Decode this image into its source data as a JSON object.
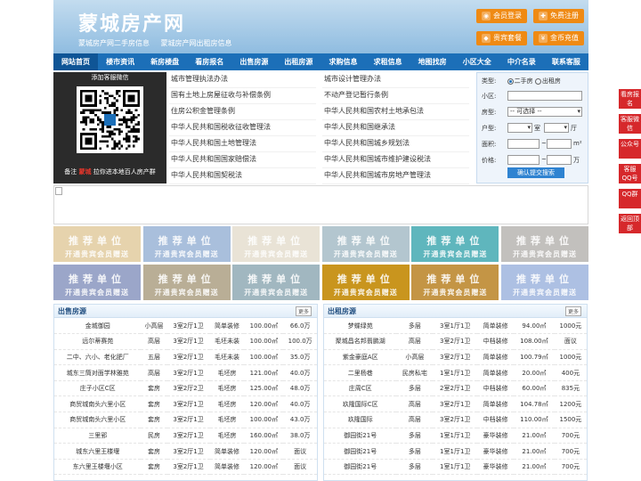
{
  "header": {
    "logo": "蒙城房产网",
    "links": [
      "蒙城房产网二手房信息",
      "蒙城房产网出租房信息"
    ],
    "buttons": [
      {
        "label": "会员登录",
        "icon": "user-icon",
        "color": "#f08c1a"
      },
      {
        "label": "免费注册",
        "icon": "register-icon",
        "color": "#f08c1a"
      },
      {
        "label": "贵宾套餐",
        "icon": "vip-icon",
        "color": "#f08c1a"
      },
      {
        "label": "金币充值",
        "icon": "coin-icon",
        "color": "#f08c1a"
      }
    ]
  },
  "nav": [
    "网站首页",
    "楼市资讯",
    "新房楼盘",
    "看房报名",
    "出售房源",
    "出租房源",
    "求购信息",
    "求租信息",
    "地图找房",
    "小区大全",
    "中介名录",
    "联系客服"
  ],
  "qr": {
    "title": "添加客服微信",
    "caption_pre": "备注",
    "caption_hl": "蒙城",
    "caption_post": "拉你进本地百人房产群"
  },
  "laws": [
    [
      "城市管理执法办法",
      "城市设计管理办法"
    ],
    [
      "国有土地上房屋征收与补偿条例",
      "不动产登记暂行条例"
    ],
    [
      "住房公积金管理条例",
      "中华人民共和国农村土地承包法"
    ],
    [
      "中华人民共和国税收征收管理法",
      "中华人民共和国继承法"
    ],
    [
      "中华人民共和国土地管理法",
      "中华人民共和国城乡规划法"
    ],
    [
      "中华人民共和国国家赔偿法",
      "中华人民共和国城市维护建设税法"
    ],
    [
      "中华人民共和国契税法",
      "中华人民共和国城市房地产管理法"
    ]
  ],
  "search": {
    "type_label": "类型:",
    "opt1": "二手房",
    "opt2": "出租房",
    "community_label": "小区:",
    "housetype_label": "房型:",
    "housetype_value": "-- 可选择 --",
    "layout_label": "户型:",
    "room": "室",
    "hall": "厅",
    "area_label": "面积:",
    "area_unit": "m²",
    "price_label": "价格:",
    "price_unit": "万",
    "dash": "~",
    "submit": "确认提交搜索"
  },
  "ads": {
    "line1": "推荐单位",
    "line2": "开通贵宾会员赠送",
    "colors": [
      "#e6d3ad",
      "#a9bfdc",
      "#e9e3d6",
      "#b3c6cf",
      "#5fb6bd",
      "#c2c0bd",
      "#9ba6c9",
      "#b9ae96",
      "#a1b7c0",
      "#c9951e",
      "#c49545",
      "#adc0e3"
    ]
  },
  "sale": {
    "title": "出售房源",
    "more": "更多",
    "rows": [
      [
        "金城御园",
        "小高层",
        "3室2厅1卫",
        "简单装修",
        "100.00㎡",
        "66.0万"
      ],
      [
        "远尔蒂赛苑",
        "高层",
        "3室2厅1卫",
        "毛坯未装",
        "100.00㎡",
        "100.0万"
      ],
      [
        "二中、六小、老化肥厂",
        "五层",
        "3室2厅1卫",
        "毛坯未装",
        "100.00㎡",
        "35.0万"
      ],
      [
        "城东三筒对面学林雅苑",
        "高层",
        "3室2厅1卫",
        "毛坯房",
        "121.00㎡",
        "40.0万"
      ],
      [
        "庄子小区C区",
        "套房",
        "3室2厅2卫",
        "毛坯房",
        "125.00㎡",
        "48.0万"
      ],
      [
        "商贸城南头六里小区",
        "套房",
        "3室2厅1卫",
        "毛坯房",
        "120.00㎡",
        "40.0万"
      ],
      [
        "商贸城南头六里小区",
        "套房",
        "3室2厅1卫",
        "毛坯房",
        "100.00㎡",
        "43.0万"
      ],
      [
        "三里郢",
        "民房",
        "3室2厅1卫",
        "毛坯房",
        "160.00㎡",
        "38.0万"
      ],
      [
        "城东六里王楼堰",
        "套房",
        "3室2厅1卫",
        "简单装修",
        "120.00㎡",
        "面议"
      ],
      [
        "东六里王楼堰小区",
        "套房",
        "3室2厅1卫",
        "简单装修",
        "120.00㎡",
        "面议"
      ]
    ]
  },
  "rent": {
    "title": "出租房源",
    "more": "更多",
    "rows": [
      [
        "梦蝶绿苑",
        "多层",
        "3室1厅1卫",
        "简单装修",
        "94.00㎡",
        "1000元"
      ],
      [
        "聚城昌名邦翡鹏湖",
        "高层",
        "3室2厅1卫",
        "中档装修",
        "108.00㎡",
        "面议"
      ],
      [
        "紫金豪庭A区",
        "小高层",
        "3室2厅1卫",
        "简单装修",
        "100.79㎡",
        "1000元"
      ],
      [
        "二里杨巷",
        "民房私宅",
        "1室1厅1卫",
        "简单装修",
        "20.00㎡",
        "400元"
      ],
      [
        "庄周C区",
        "多层",
        "2室2厅1卫",
        "中档装修",
        "60.00㎡",
        "835元"
      ],
      [
        "玖隆国际C区",
        "高层",
        "3室2厅1卫",
        "简单装修",
        "104.78㎡",
        "1200元"
      ],
      [
        "玖隆国际",
        "高层",
        "3室2厅1卫",
        "中档装修",
        "110.00㎡",
        "1500元"
      ],
      [
        "御园街21号",
        "多层",
        "1室1厅1卫",
        "豪华装修",
        "21.00㎡",
        "700元"
      ],
      [
        "御园街21号",
        "多层",
        "1室1厅1卫",
        "豪华装修",
        "21.00㎡",
        "700元"
      ],
      [
        "御园街21号",
        "多层",
        "1室1厅1卫",
        "豪华装修",
        "21.00㎡",
        "700元"
      ]
    ]
  },
  "sidebar": [
    "看房报名",
    "客服微信",
    "公众号",
    "客服QQ号",
    "QQ群",
    "返回顶部"
  ]
}
